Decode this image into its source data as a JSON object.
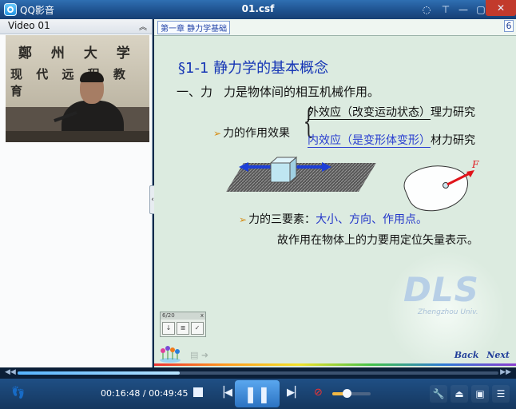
{
  "titlebar": {
    "app_name": "QQ影音",
    "file_title": "01.csf",
    "icons": [
      "chat-icon",
      "pin-icon",
      "minimize-icon",
      "maximize-icon",
      "close-icon"
    ]
  },
  "left_panel": {
    "title": "Video 01",
    "video_text_row1": "鄭 州 大 学",
    "video_text_row2": "现 代 远 程 教 育"
  },
  "slide": {
    "chapter": "第一章 静力学基础",
    "page": "6",
    "heading": "§1-1 静力学的基本概念",
    "line1_prefix": "一、力",
    "line1_text": "力是物体间的相互机械作用。",
    "effects_label": "力的作用效果",
    "effect_outer": "外效应（改变运动状态）",
    "effect_outer_tail": "理力研究",
    "effect_inner": "内效应（是变形体变形）",
    "effect_inner_tail": "材力研究",
    "force_label": "F",
    "elements_prefix": "力的三要素：",
    "elements_values": "大小、方向、作用点。",
    "conclusion": "故作用在物体上的力要用定位矢量表示。",
    "watermark": "DLS",
    "watermark_sub": "Zhengzhou Univ.",
    "mini_page": "6/20",
    "nav_back": "Back",
    "nav_next": "Next"
  },
  "player": {
    "time_current": "00:16:48",
    "time_separator": " / ",
    "time_total": "00:49:45",
    "progress_fraction": 0.338,
    "volume_fraction": 0.38,
    "accent": "#2c73c2"
  }
}
